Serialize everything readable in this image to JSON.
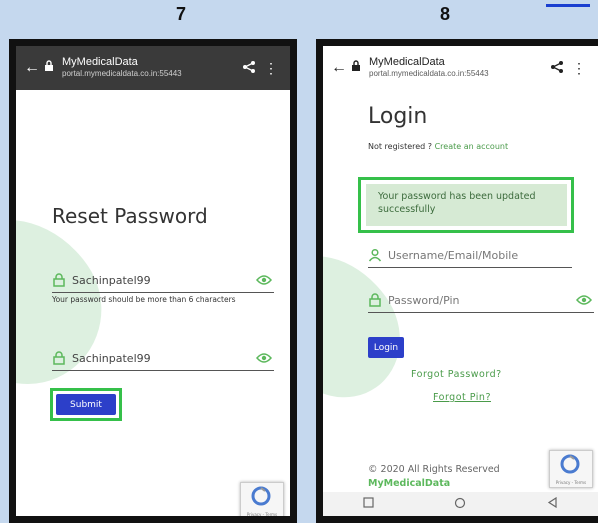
{
  "steps": {
    "left": "7",
    "right": "8"
  },
  "phone7": {
    "browser": {
      "site": "MyMedicalData",
      "url": "portal.mymedicaldata.co.in:55443"
    },
    "title": "Reset Password",
    "password_field": {
      "value": "Sachinpatel99"
    },
    "hint": "Your password should be more than 6 characters",
    "confirm_field": {
      "value": "Sachinpatel99"
    },
    "submit_label": "Submit",
    "captcha_caption": "Privacy - Terms"
  },
  "phone8": {
    "browser": {
      "site": "MyMedicalData",
      "url": "portal.mymedicaldata.co.in:55443"
    },
    "title": "Login",
    "not_registered": "Not registered ?",
    "create_account": "Create an account",
    "alert": "Your password has been updated successfully",
    "username_placeholder": "Username/Email/Mobile",
    "password_placeholder": "Password/Pin",
    "login_label": "Login",
    "forgot_password": "Forgot Password?",
    "forgot_pin": "Forgot Pin?",
    "copyright": "© 2020 All Rights Reserved",
    "brand": "MyMedicalData",
    "captcha_caption": "Privacy - Terms"
  },
  "colors": {
    "accent_green": "#35c04a",
    "button_blue": "#2c3fc9",
    "page_bg": "#c5d8ee"
  }
}
